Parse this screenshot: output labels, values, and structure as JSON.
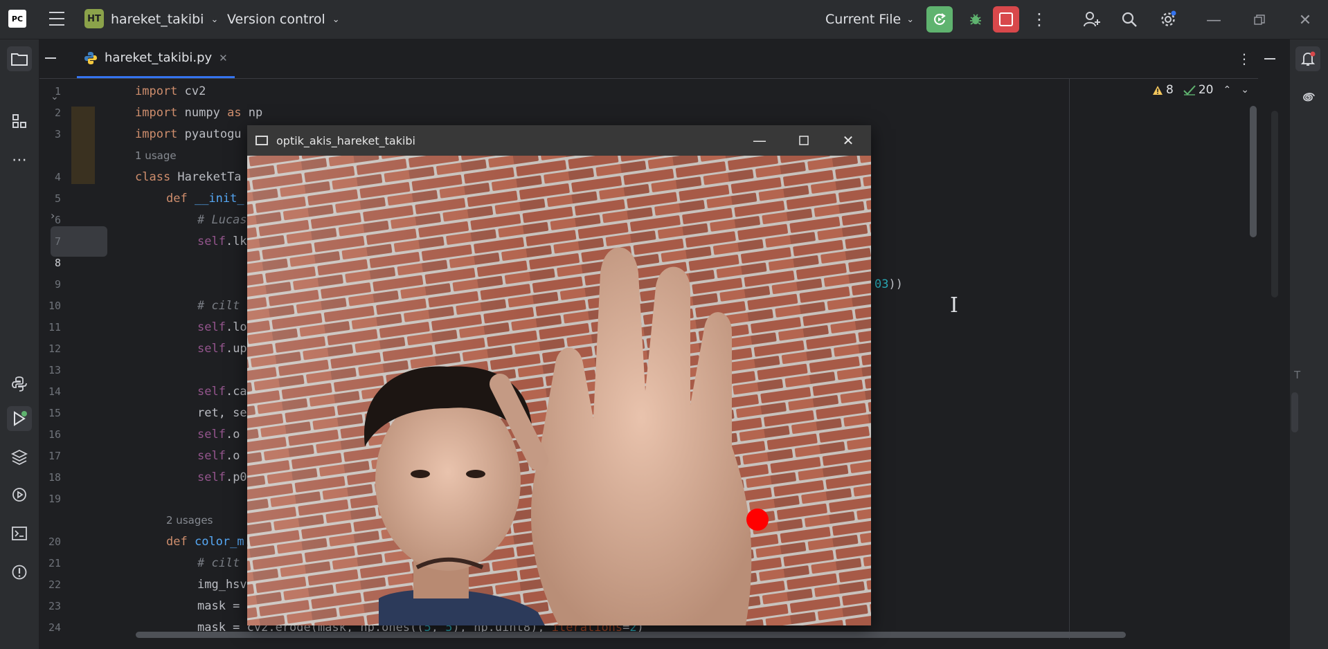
{
  "topbar": {
    "ide_logo": "PC",
    "project_badge": "HT",
    "project_name": "hareket_takibi",
    "version_control": "Version control",
    "run_config": "Current File"
  },
  "tab": {
    "file_name": "hareket_takibi.py"
  },
  "inspections": {
    "warnings": "8",
    "weak_warnings": "20"
  },
  "code": {
    "l1_kw": "import",
    "l1_rest": " cv2",
    "l2_kw": "import",
    "l2_mod": " numpy ",
    "l2_as": "as",
    "l2_alias": " np",
    "l3_kw": "import",
    "l3_rest": " pyautogu",
    "hint_usage1": "1 usage",
    "l4_kw": "class",
    "l4_name": " HareketTa",
    "l5_kw": "def",
    "l5_name": " __init_",
    "l6_cm": "# Lucas",
    "l7_self": "self",
    "l7_rest": ".lk",
    "l8_tail_num": "03",
    "l8_tail_par": "))",
    "l10_cm": "# cilt",
    "l11_self": "self",
    "l11_rest": ".lo",
    "l12_self": "self",
    "l12_rest": ".up",
    "l14_self": "self",
    "l14_rest": ".ca",
    "l15_rest": "ret, se",
    "l16_self": "self",
    "l16_rest": ".o",
    "l17_self": "self",
    "l17_rest": ".o",
    "l18_self": "self",
    "l18_rest": ".p0",
    "hint_usages2": "2 usages",
    "l20_kw": "def",
    "l20_name": " color_m",
    "l21_cm": "# cilt",
    "l22_rest": "img_hsv",
    "l23_rest": "mask =",
    "l24_a": "mask = cv2.erode(mask, np.ones((",
    "l24_n1": "5",
    "l24_b": ", ",
    "l24_n2": "5",
    "l24_c": "), np.uint8), ",
    "l24_param": "iterations",
    "l24_d": "=",
    "l24_n3": "2",
    "l24_e": ")"
  },
  "opencv_window": {
    "title": "optik_akis_hareket_takibi"
  },
  "right_edge_label": "T",
  "colors": {
    "accent": "#3574f0",
    "run": "#5fb36f",
    "stop": "#d8484b",
    "tracking_dot": "#ff0000"
  }
}
